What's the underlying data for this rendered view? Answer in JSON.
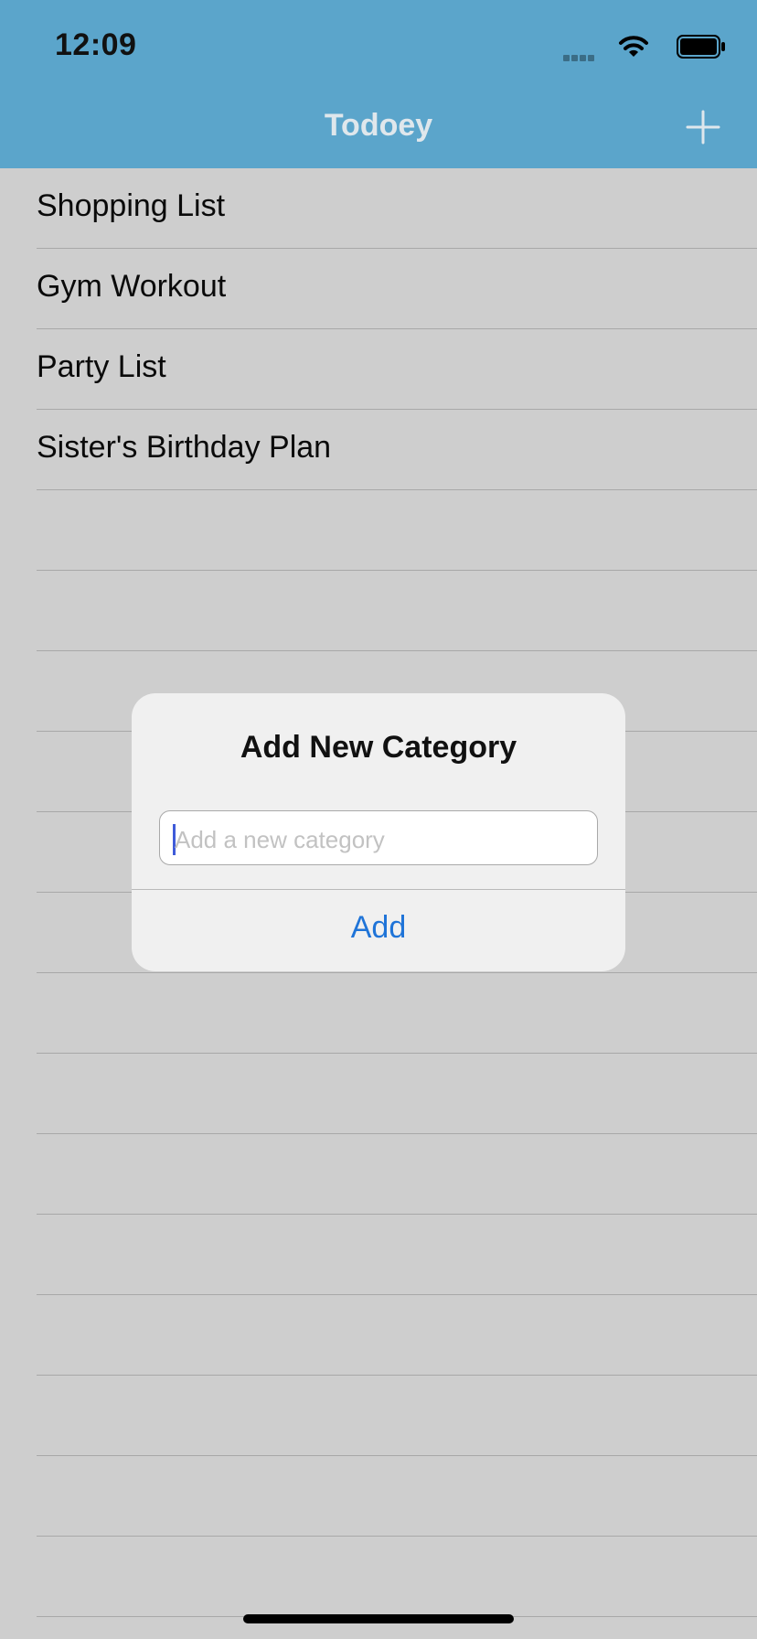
{
  "status_bar": {
    "time": "12:09"
  },
  "nav": {
    "title": "Todoey",
    "add_icon": "plus-icon"
  },
  "categories": [
    {
      "label": "Shopping List"
    },
    {
      "label": "Gym Workout"
    },
    {
      "label": "Party List"
    },
    {
      "label": "Sister's Birthday Plan"
    }
  ],
  "empty_rows": 14,
  "dialog": {
    "title": "Add New Category",
    "input_placeholder": "Add a new category",
    "input_value": "",
    "action_label": "Add"
  },
  "colors": {
    "header": "#5ba5cb",
    "background": "#cecece",
    "action": "#1f74d8"
  }
}
